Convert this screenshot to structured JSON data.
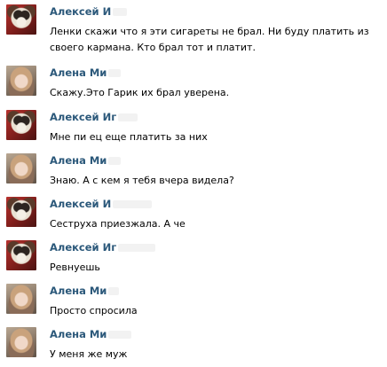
{
  "messages": [
    {
      "author": "Алексей И",
      "avatar": "dog-avatar",
      "text": "Ленки скажи что я эти сигареты не брал. Ни буду платить из своего кармана. Кто брал тот и платит."
    },
    {
      "author": "Алена Ми",
      "avatar": "girl-avatar",
      "text": "Скажу.Это Гарик их брал уверена."
    },
    {
      "author": "Алексей Иг",
      "avatar": "dog-avatar",
      "text": "Мне пи    ец еще платить за них"
    },
    {
      "author": "Алена Ми",
      "avatar": "girl-avatar",
      "text": "Знаю. А с кем я тебя вчера видела?"
    },
    {
      "author": "Алексей И",
      "avatar": "dog-avatar",
      "text": "Сеструха приезжала. А че"
    },
    {
      "author": "Алексей Иг",
      "avatar": "dog-avatar",
      "text": "Ревнуешь"
    },
    {
      "author": "Алена Ми",
      "avatar": "girl-avatar",
      "text": "Просто спросила"
    },
    {
      "author": "Алена Ми",
      "avatar": "girl-avatar",
      "text": "У меня же муж"
    }
  ]
}
